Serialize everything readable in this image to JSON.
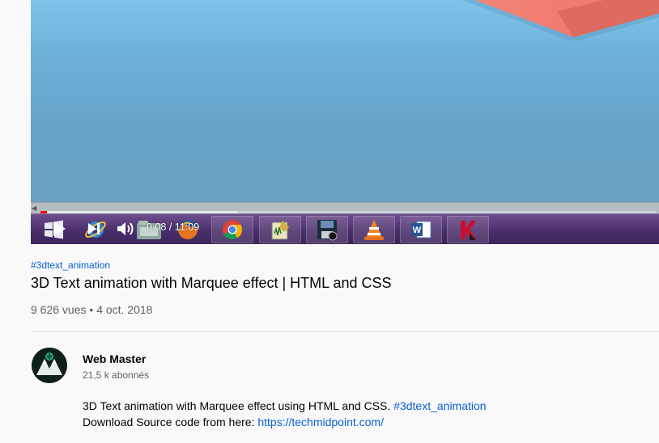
{
  "player": {
    "current_time": "0:08",
    "duration": "11:09",
    "time_separator": "/",
    "progress_fraction": 0.011,
    "buffered_fraction": 0.32,
    "colors": {
      "progress": "#ff0000",
      "taskbar": "#4a2f6b",
      "sky": "#75aed0",
      "box": "#f07f76"
    },
    "taskbar_apps": [
      {
        "name": "windows-start-icon"
      },
      {
        "name": "internet-explorer-icon"
      },
      {
        "name": "file-manager-icon"
      },
      {
        "name": "firefox-icon"
      },
      {
        "name": "chrome-icon"
      },
      {
        "name": "notepad-icon"
      },
      {
        "name": "save-disk-icon"
      },
      {
        "name": "vlc-icon"
      },
      {
        "name": "word-icon"
      },
      {
        "name": "kaspersky-icon"
      }
    ]
  },
  "video": {
    "hashtag": "#3dtext_animation",
    "title": "3D Text animation with Marquee effect | HTML and CSS",
    "views": "9 626 vues",
    "meta_separator": "•",
    "date": "4 oct. 2018"
  },
  "channel": {
    "name": "Web Master",
    "subscribers": "21,5 k abonnés",
    "avatar_icon": "webmaster-logo-icon"
  },
  "description": {
    "line1_text": "3D Text animation with Marquee effect using HTML and CSS.",
    "line1_hashtag": "#3dtext_animation",
    "line2_text": "Download Source code from here:",
    "line2_link": "https://techmidpoint.com/"
  },
  "colors": {
    "link": "#065fd4",
    "text": "#030303",
    "secondary": "#606060",
    "background": "#f9f9f9"
  }
}
